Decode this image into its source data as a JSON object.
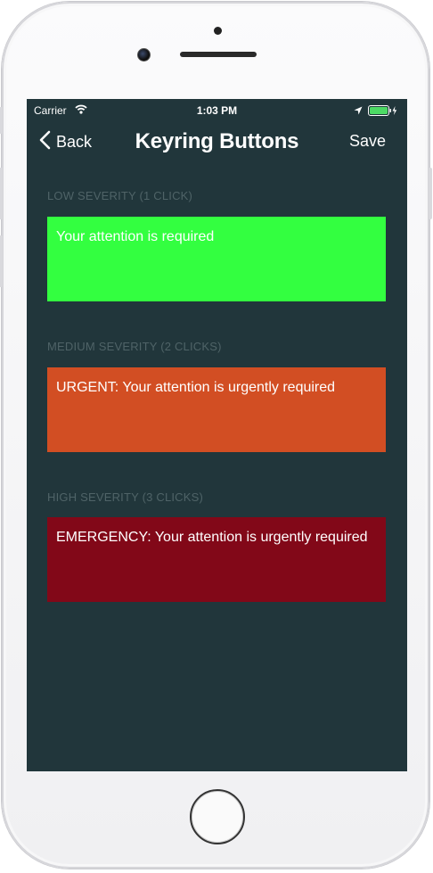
{
  "status_bar": {
    "carrier": "Carrier",
    "time": "1:03 PM"
  },
  "nav": {
    "back_label": "Back",
    "title": "Keyring Buttons",
    "save_label": "Save"
  },
  "sections": [
    {
      "header": "LOW SEVERITY (1 CLICK)",
      "message": "Your attention is required",
      "color": "#33ff40"
    },
    {
      "header": "MEDIUM SEVERITY (2 CLICKS)",
      "message": "URGENT: Your attention is urgently required",
      "color": "#d24e23"
    },
    {
      "header": "HIGH SEVERITY (3 CLICKS)",
      "message": "EMERGENCY: Your attention is urgently required",
      "color": "#820818"
    }
  ],
  "colors": {
    "screen_background": "#21363b",
    "section_header": "#4f6367",
    "battery": "#4cd964"
  }
}
